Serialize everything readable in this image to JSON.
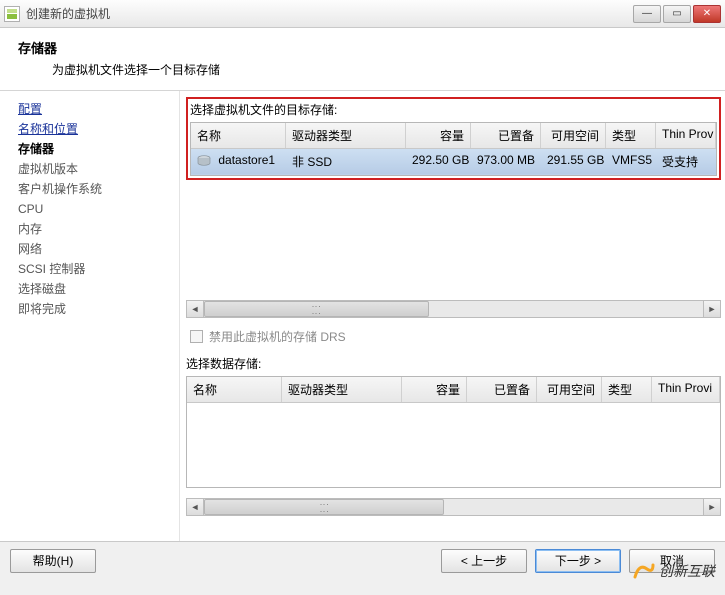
{
  "window": {
    "title": "创建新的虚拟机",
    "header_title": "存储器",
    "header_subtitle": "为虚拟机文件选择一个目标存储"
  },
  "sidebar": {
    "steps": [
      {
        "label": "配置",
        "state": "link"
      },
      {
        "label": "名称和位置",
        "state": "link"
      },
      {
        "label": "存储器",
        "state": "current"
      },
      {
        "label": "虚拟机版本",
        "state": "pending"
      },
      {
        "label": "客户机操作系统",
        "state": "pending"
      },
      {
        "label": "CPU",
        "state": "pending"
      },
      {
        "label": "内存",
        "state": "pending"
      },
      {
        "label": "网络",
        "state": "pending"
      },
      {
        "label": "SCSI 控制器",
        "state": "pending"
      },
      {
        "label": "选择磁盘",
        "state": "pending"
      },
      {
        "label": "即将完成",
        "state": "pending"
      }
    ]
  },
  "content": {
    "select_label": "选择虚拟机文件的目标存储:",
    "columns": {
      "name": "名称",
      "drive_type": "驱动器类型",
      "capacity": "容量",
      "provisioned": "已置备",
      "free": "可用空间",
      "type": "类型",
      "thin": "Thin Prov"
    },
    "datastores": [
      {
        "name": "datastore1",
        "drive_type": "非 SSD",
        "capacity": "292.50 GB",
        "provisioned": "973.00 MB",
        "free": "291.55 GB",
        "type": "VMFS5",
        "thin": "受支持"
      }
    ],
    "disable_drs_label": "禁用此虚拟机的存储 DRS",
    "secondary_label": "选择数据存储:",
    "columns2": {
      "name": "名称",
      "drive_type": "驱动器类型",
      "capacity": "容量",
      "provisioned": "已置备",
      "free": "可用空间",
      "type": "类型",
      "thin": "Thin Provi"
    }
  },
  "footer": {
    "help": "帮助(H)",
    "back": "< 上一步",
    "next": "下一步 >",
    "cancel": "取消"
  },
  "watermark": "创新互联"
}
